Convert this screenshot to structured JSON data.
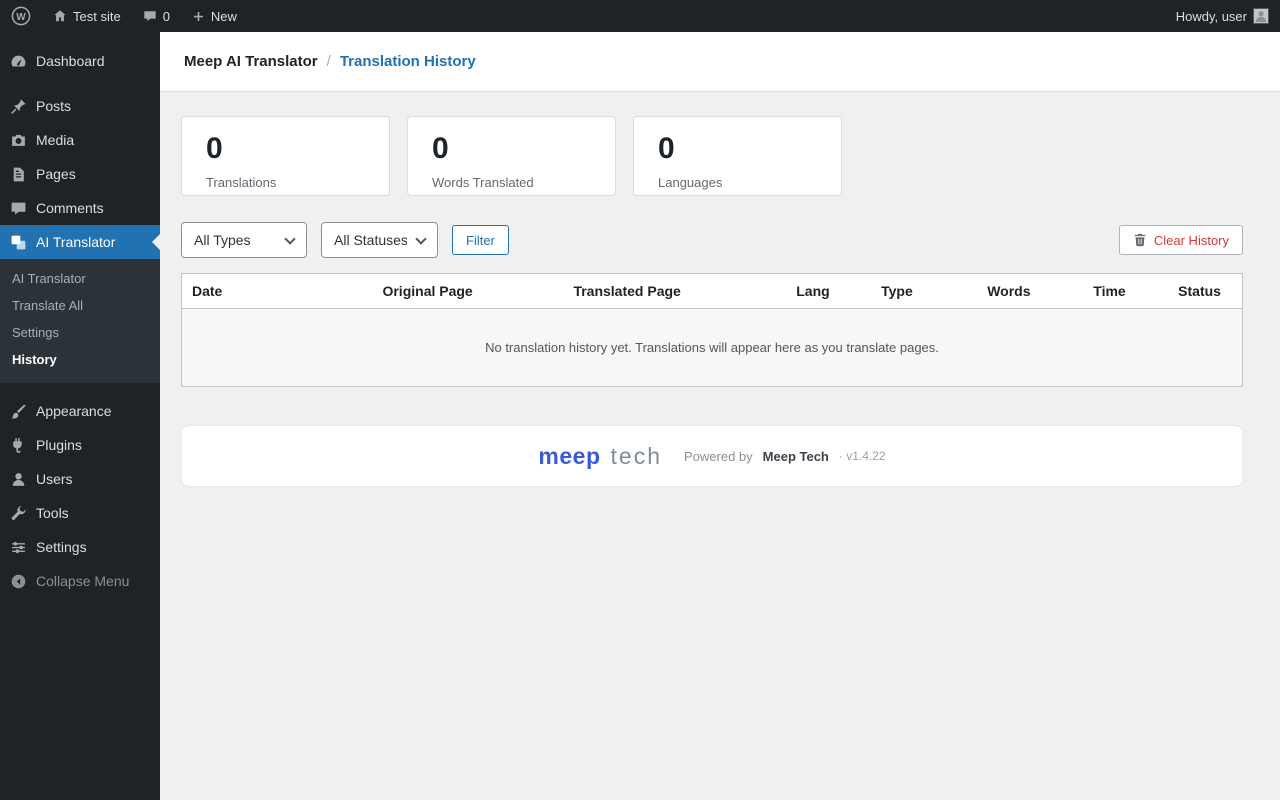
{
  "admin_bar": {
    "site_name": "Test site",
    "comments_count": "0",
    "new_label": "New",
    "howdy_text": "Howdy, user"
  },
  "sidebar": {
    "items": [
      {
        "label": "Dashboard"
      },
      {
        "label": "Posts"
      },
      {
        "label": "Media"
      },
      {
        "label": "Pages"
      },
      {
        "label": "Comments"
      },
      {
        "label": "AI Translator"
      },
      {
        "label": "Appearance"
      },
      {
        "label": "Plugins"
      },
      {
        "label": "Users"
      },
      {
        "label": "Tools"
      },
      {
        "label": "Settings"
      }
    ],
    "active_item": "AI Translator",
    "submenu": [
      "AI Translator",
      "Translate All",
      "Settings",
      "History"
    ],
    "active_submenu": "History",
    "collapse_label": "Collapse Menu"
  },
  "breadcrumb": {
    "parent": "Meep AI Translator",
    "separator": "/",
    "current": "Translation History"
  },
  "stats": [
    {
      "value": "0",
      "label": "Translations"
    },
    {
      "value": "0",
      "label": "Words Translated"
    },
    {
      "value": "0",
      "label": "Languages"
    }
  ],
  "filters": {
    "type_value": "All Types",
    "status_value": "All Statuses",
    "filter_label": "Filter",
    "clear_label": "Clear History"
  },
  "table": {
    "headers": [
      "Date",
      "Original Page",
      "Translated Page",
      "Lang",
      "Type",
      "Words",
      "Time",
      "Status"
    ],
    "empty_message": "No translation history yet. Translations will appear here as you translate pages."
  },
  "footer": {
    "brand_primary": "meep",
    "brand_secondary": "tech",
    "powered_prefix": "Powered by",
    "brand_name": "Meep Tech",
    "version_text": "· v1.4.22"
  },
  "icons": {
    "wordpress-logo": "W-in-circle",
    "home-icon": "house",
    "comments-icon": "speech-bubble",
    "new-icon": "plus",
    "avatar": "person-silhouette",
    "trash-icon": "trash-can",
    "select-chevron-icon": "chevron-down",
    "collapse-icon": "circle-left-arrow"
  },
  "colors": {
    "admin_dark": "#1d2327",
    "submenu_dark": "#2c3338",
    "accent_blue": "#2271b1",
    "danger_red": "#d63638",
    "brand_blue": "#3a5bd9",
    "content_bg": "#f0f0f1"
  }
}
